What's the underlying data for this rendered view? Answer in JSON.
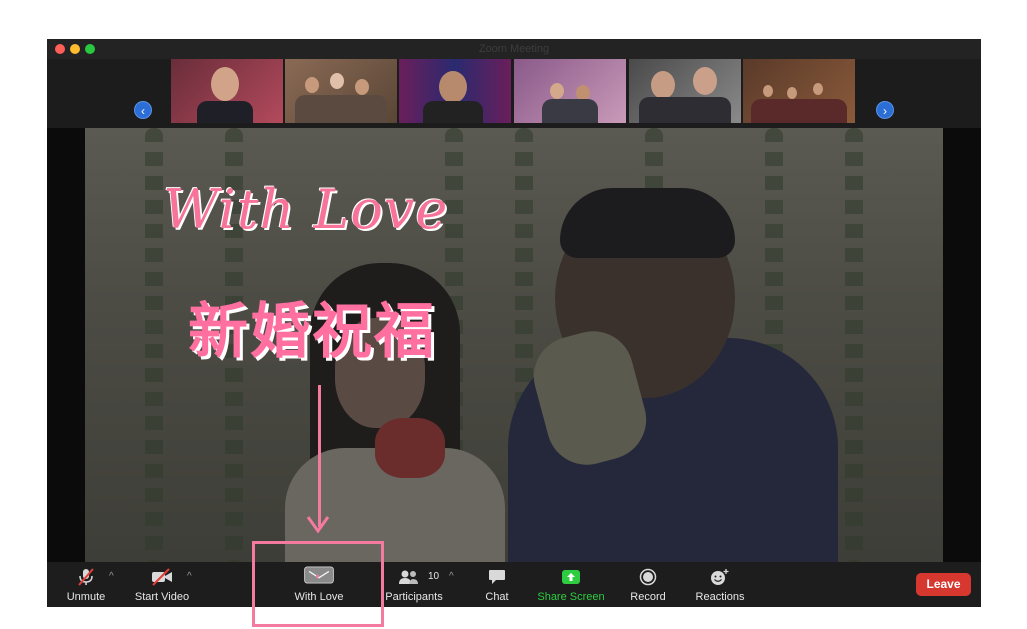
{
  "window": {
    "title": "Zoom Meeting"
  },
  "gallery": {
    "prev_icon": "chevron-left-icon",
    "next_icon": "chevron-right-icon",
    "thumbnail_count": 6
  },
  "toolbar": {
    "unmute_label": "Unmute",
    "start_video_label": "Start Video",
    "with_love_label": "With Love",
    "participants_label": "Participants",
    "participants_count": "10",
    "chat_label": "Chat",
    "share_screen_label": "Share Screen",
    "record_label": "Record",
    "reactions_label": "Reactions",
    "leave_label": "Leave"
  },
  "overlay": {
    "title": "With Love",
    "subtitle": "新婚祝福"
  },
  "colors": {
    "accent_pink": "#f47aa0",
    "leave_red": "#d6382f",
    "share_green": "#2ecc40",
    "nav_blue": "#2b6fd6"
  }
}
